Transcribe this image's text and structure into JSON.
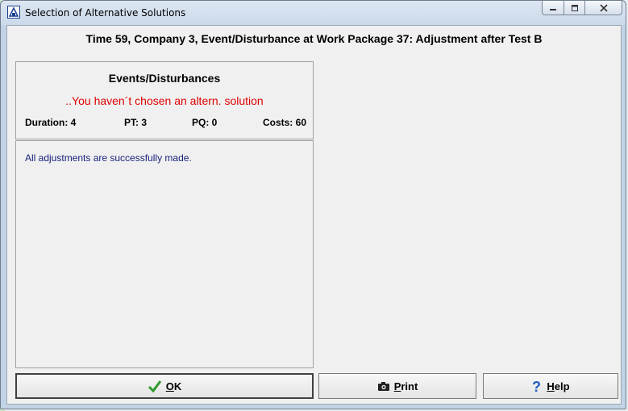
{
  "window": {
    "title": "Selection of Alternative Solutions",
    "controls": {
      "minimize": "▭",
      "maximize": "▢",
      "close": "✕"
    }
  },
  "header": {
    "title": "Time 59, Company 3, Event/Disturbance at Work Package 37: Adjustment after Test B"
  },
  "events": {
    "title": "Events/Disturbances",
    "status": "..You haven´t chosen an altern. solution",
    "stats": {
      "duration": "Duration: 4",
      "pt": "PT: 3",
      "pq": "PQ: 0",
      "costs": "Costs: 60"
    }
  },
  "description": {
    "text": "All adjustments are successfully made."
  },
  "buttons": {
    "ok": {
      "first": "O",
      "rest": "K"
    },
    "print": {
      "first": "P",
      "rest": "rint"
    },
    "help": {
      "first": "H",
      "rest": "elp"
    }
  },
  "colors": {
    "status_red": "#e00000",
    "description_blue": "#1a237e",
    "check_green": "#2e9b2e",
    "help_blue": "#1f5fbf"
  }
}
